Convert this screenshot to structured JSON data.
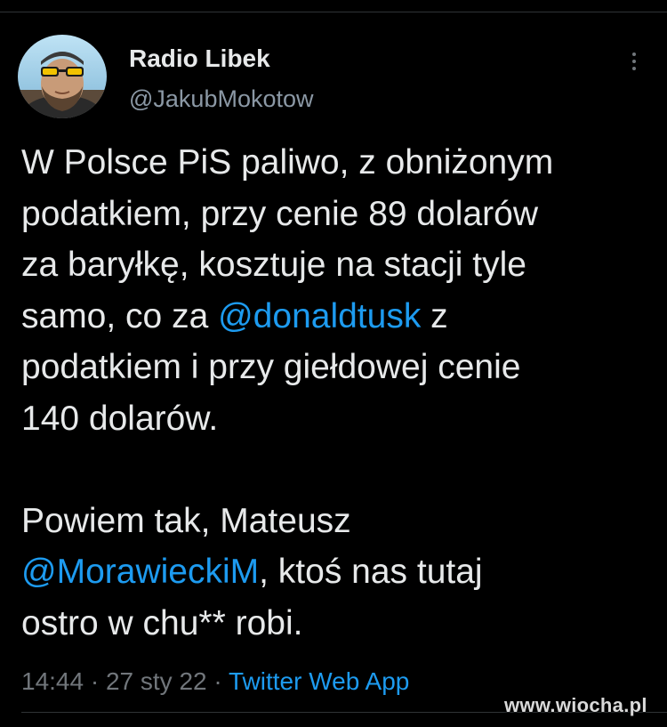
{
  "tweet": {
    "author": {
      "display_name": "Radio Libek",
      "handle": "@JakubMokotow",
      "avatar_icon": "profile-photo"
    },
    "more_icon": "vertical-dots-icon",
    "paragraphs": [
      {
        "lines": [
          [
            {
              "text": "W Polsce PiS paliwo, z obniżonym"
            }
          ],
          [
            {
              "text": "podatkiem, przy cenie 89 dolarów"
            }
          ],
          [
            {
              "text": "za baryłkę, kosztuje na stacji tyle"
            }
          ],
          [
            {
              "text": "samo, co za "
            },
            {
              "text": "@donaldtusk",
              "mention": true
            },
            {
              "text": " z"
            }
          ],
          [
            {
              "text": "podatkiem i przy giełdowej cenie"
            }
          ],
          [
            {
              "text": "140 dolarów."
            }
          ]
        ]
      },
      {
        "lines": [
          [
            {
              "text": "Powiem tak, Mateusz"
            }
          ],
          [
            {
              "text": "@MorawieckiM",
              "mention": true
            },
            {
              "text": ", ktoś nas tutaj"
            }
          ],
          [
            {
              "text": "ostro w chu** robi."
            }
          ]
        ]
      }
    ],
    "meta": {
      "time": "14:44",
      "separator": " · ",
      "date": "27 sty 22",
      "source": "Twitter Web App"
    }
  },
  "watermark": "www.wiocha.pl",
  "colors": {
    "background": "#000000",
    "text": "#e7e9ea",
    "secondary_text": "#71767b",
    "mention": "#1d9bf0"
  }
}
